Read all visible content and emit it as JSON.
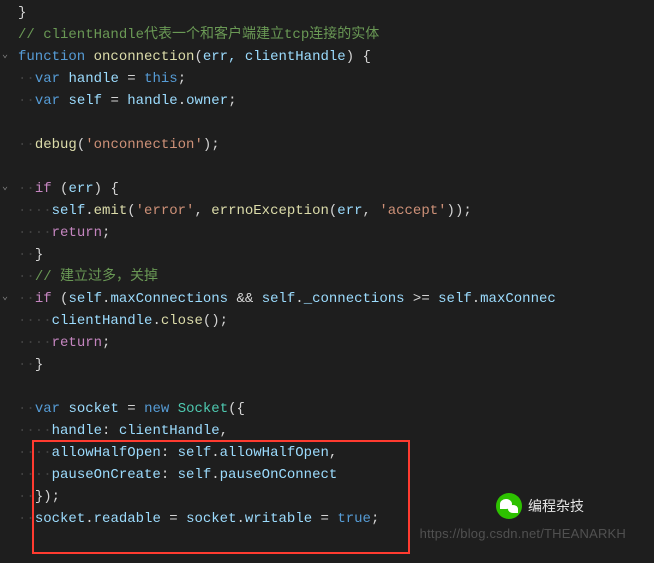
{
  "code": {
    "l1": "}",
    "l2_comment": "// clientHandle代表一个和客户端建立tcp连接的实体",
    "l3": {
      "kw_function": "function",
      "name": "onconnection",
      "params": "err, clientHandle",
      "brace": " {"
    },
    "l4": {
      "kw_var": "var",
      "id": "handle",
      "eq": " = ",
      "kw_this": "this",
      "semi": ";"
    },
    "l5": {
      "kw_var": "var",
      "id": "self",
      "eq": " = ",
      "rhs_obj": "handle",
      "dot": ".",
      "rhs_prop": "owner",
      "semi": ";"
    },
    "l7": {
      "fn": "debug",
      "arg": "'onconnection'",
      "tail": ";"
    },
    "l9": {
      "kw_if": "if",
      "cond": "err",
      "brace": " {"
    },
    "l10": {
      "obj": "self",
      "dot": ".",
      "fn": "emit",
      "arg1": "'error'",
      "sep": ", ",
      "fn2": "errnoException",
      "arg2a": "err",
      "sep2": ", ",
      "arg2b": "'accept'",
      "tail": ");"
    },
    "l11": {
      "kw_return": "return",
      "semi": ";"
    },
    "l12": "}",
    "l13_comment": "// 建立过多，关掉",
    "l14": {
      "kw_if": "if",
      "open": " (",
      "obj": "self",
      "dot": ".",
      "prop": "maxConnections",
      "andand": " && ",
      "obj2": "self",
      "dot2": ".",
      "prop2": "_connections",
      "cmp": " >= ",
      "obj3": "self",
      "dot3": ".",
      "prop3": "maxConnec"
    },
    "l15": {
      "obj": "clientHandle",
      "dot": ".",
      "fn": "close",
      "tail": "();"
    },
    "l16": {
      "kw_return": "return",
      "semi": ";"
    },
    "l17": "}",
    "l19": {
      "kw_var": "var",
      "id": "socket",
      "eq": " = ",
      "kw_new": "new",
      "cls": "Socket",
      "open": "({"
    },
    "l20": {
      "key": "handle",
      "sep": ": ",
      "val": "clientHandle",
      "comma": ","
    },
    "l21": {
      "key": "allowHalfOpen",
      "sep": ": ",
      "obj": "self",
      "dot": ".",
      "prop": "allowHalfOpen",
      "comma": ","
    },
    "l22": {
      "key": "pauseOnCreate",
      "sep": ": ",
      "obj": "self",
      "dot": ".",
      "prop": "pauseOnConnect"
    },
    "l23": "});",
    "l24": {
      "obj": "socket",
      "dot": ".",
      "prop": "readable",
      "eq": " = ",
      "obj2": "socket",
      "dot2": ".",
      "prop2": "writable",
      "eq2": " = ",
      "val": "true",
      "semi": ";"
    }
  },
  "watermark": "https://blog.csdn.net/THEANARKH",
  "wechat_label": "编程杂技"
}
